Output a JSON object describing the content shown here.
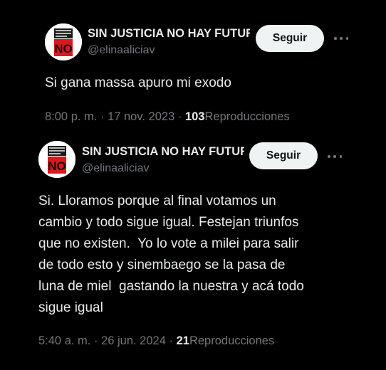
{
  "tweets": [
    {
      "display_name": "SIN JUSTICIA NO HAY FUTURO",
      "handle": "@elinaaliciav",
      "follow_label": "Seguir",
      "avatar_text": "NO",
      "body": "Si gana massa apuro mi exodo",
      "time": "8:00 p. m.",
      "date": "17 nov. 2023",
      "separator": "·",
      "views_count": "103",
      "views_label": "Reproducciones"
    },
    {
      "display_name": "SIN JUSTICIA NO HAY FUTURO",
      "handle": "@elinaaliciav",
      "follow_label": "Seguir",
      "avatar_text": "NO",
      "body": "Si. Lloramos porque al final votamos un\ncambio y todo sigue igual. Festejan triunfos\nque no existen.  Yo lo vote a milei para salir\nde todo esto y sinembaego se la pasa de\nluna de miel  gastando la nuestra y acá todo\nsigue igual",
      "time": "5:40 a. m.",
      "date": "26 jun. 2024",
      "separator": "·",
      "views_count": "21",
      "views_label": "Reproducciones"
    }
  ],
  "colors": {
    "background": "#000000",
    "text": "#e7e9ea",
    "muted": "#71767b",
    "button_bg": "#eff3f4",
    "avatar_red": "#d71920"
  }
}
